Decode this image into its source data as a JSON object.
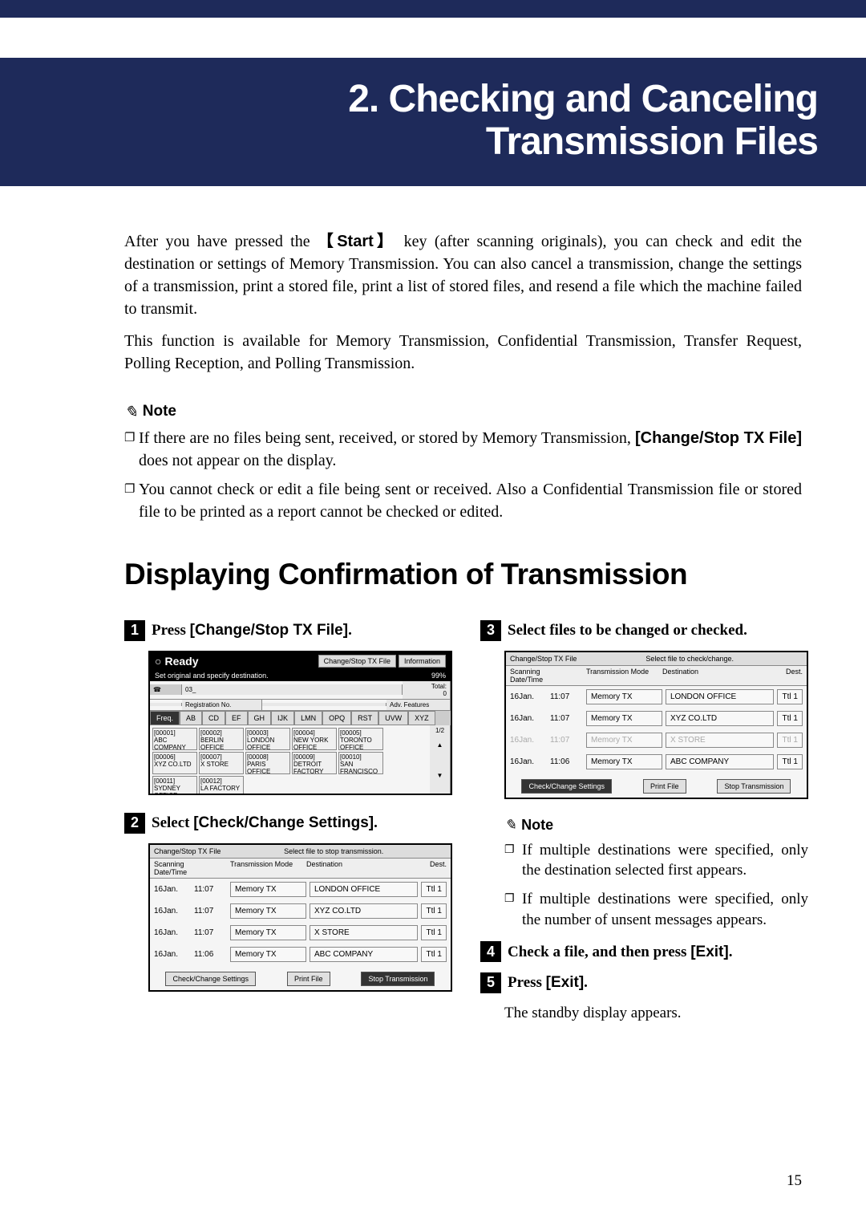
{
  "chapter": {
    "title_line1": "2. Checking and Canceling",
    "title_line2": "Transmission Files"
  },
  "intro": {
    "p1_before": "After you have pressed the ",
    "p1_key": "【Start】",
    "p1_after": " key (after scanning originals), you can check and edit the destination or settings of Memory Transmission. You can also cancel a transmission, change the settings of a transmission, print a stored file, print a list of stored files, and resend a file which the machine failed to transmit.",
    "p2": "This function is available for Memory Transmission, Confidential Transmission, Transfer Request, Polling Reception, and Polling Transmission."
  },
  "note_label": "Note",
  "pencil_icon": "✎",
  "notes": {
    "n1_before": "If there are no files being sent, received, or stored by Memory Transmission, ",
    "n1_bold": "[Change/Stop TX File]",
    "n1_after": " does not appear on the display.",
    "n2": "You cannot check or edit a file being sent or received. Also a Confidential Transmission file or stored file to be printed as a report cannot be checked or edited."
  },
  "section_title": "Displaying Confirmation of Transmission",
  "steps": {
    "s1_before": "Press ",
    "s1_bold": "[Change/Stop TX File]",
    "s1_after": ".",
    "s2_before": "Select ",
    "s2_bold": "[Check/Change Settings]",
    "s2_after": ".",
    "s3": "Select files to be changed or checked.",
    "s4_before": "Check a file, and then press ",
    "s4_bold": "[Exit]",
    "s4_after": ".",
    "s5_before": "Press ",
    "s5_bold": "[Exit]",
    "s5_after": ".",
    "s5_follow": "The standby display appears."
  },
  "col_notes": {
    "n1": "If multiple destinations were specified, only the destination selected first appears.",
    "n2": "If multiple destinations were specified, only the number of unsent messages appears."
  },
  "ss1": {
    "ready": "Ready",
    "btn1": "Change/Stop TX File",
    "btn2": "Information",
    "sub": "Set original and specify destination.",
    "pct": "99%",
    "phone": "03_",
    "total_label": "Total:",
    "total": "0",
    "reg": "Registration No.",
    "adv": "Adv. Features",
    "freq": "Freq.",
    "tabs": [
      "AB",
      "CD",
      "EF",
      "GH",
      "IJK",
      "LMN",
      "OPQ",
      "RST",
      "UVW",
      "XYZ"
    ],
    "page": "1/2",
    "dests": [
      {
        "id": "[00001]",
        "n": "ABC COMPANY"
      },
      {
        "id": "[00002]",
        "n": "BERLIN OFFICE"
      },
      {
        "id": "[00003]",
        "n": "LONDON OFFICE"
      },
      {
        "id": "[00004]",
        "n": "NEW YORK OFFICE"
      },
      {
        "id": "[00005]",
        "n": "TORONTO OFFICE"
      },
      {
        "id": "[00006]",
        "n": "XYZ CO.LTD"
      },
      {
        "id": "[00007]",
        "n": "X STORE"
      },
      {
        "id": "[00008]",
        "n": "PARIS OFFICE"
      },
      {
        "id": "[00009]",
        "n": "DETROIT FACTORY"
      },
      {
        "id": "[00010]",
        "n": "SAN FRANCISCO"
      },
      {
        "id": "[00011]",
        "n": "SYDNEY OFFICE"
      },
      {
        "id": "[00012]",
        "n": "LA FACTORY"
      }
    ]
  },
  "ss2_header": "Select file to stop transmission.",
  "ss3_header": "Select file to check/change.",
  "ss_table": {
    "top": "Change/Stop TX File",
    "cols": {
      "date": "Scanning Date/Time",
      "mode": "Transmission Mode",
      "dest": "Destination",
      "num": "Dest."
    },
    "rows": [
      {
        "date": "16Jan.",
        "time": "11:07",
        "mode": "Memory TX",
        "dest": "LONDON OFFICE",
        "ttl": "Ttl",
        "n": "1"
      },
      {
        "date": "16Jan.",
        "time": "11:07",
        "mode": "Memory TX",
        "dest": "XYZ CO.LTD",
        "ttl": "Ttl",
        "n": "1"
      },
      {
        "date": "16Jan.",
        "time": "11:07",
        "mode": "Memory TX",
        "dest": "X STORE",
        "ttl": "Ttl",
        "n": "1"
      },
      {
        "date": "16Jan.",
        "time": "11:06",
        "mode": "Memory TX",
        "dest": "ABC COMPANY",
        "ttl": "Ttl",
        "n": "1"
      }
    ],
    "btns": {
      "check": "Check/Change Settings",
      "print": "Print File",
      "stop": "Stop Transmission"
    }
  },
  "bullet_char": "❐",
  "page_number": "15"
}
